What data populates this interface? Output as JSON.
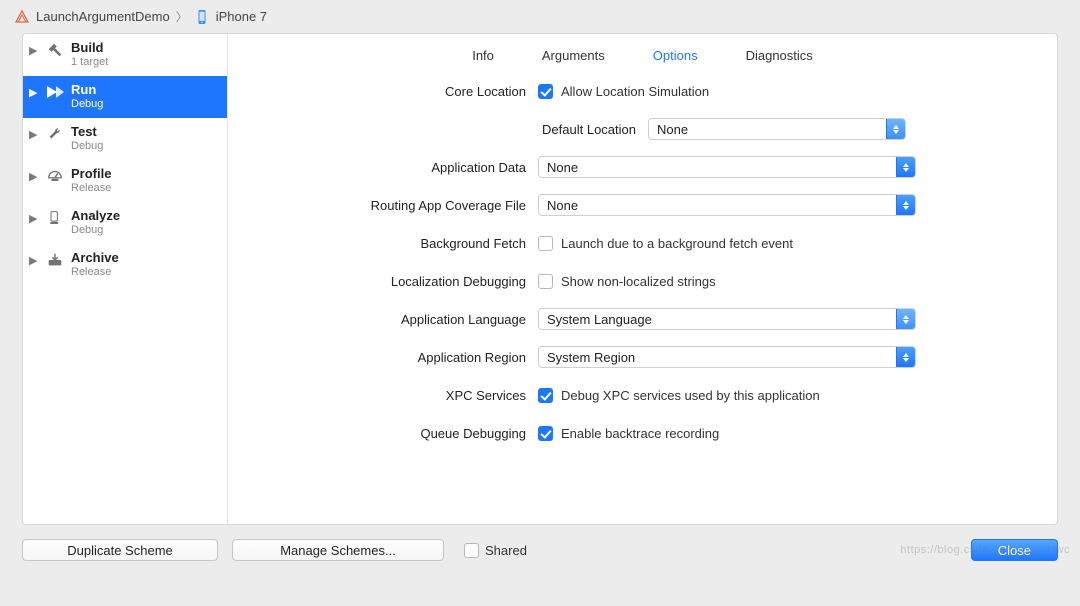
{
  "breadcrumb": {
    "scheme": "LaunchArgumentDemo",
    "device": "iPhone 7"
  },
  "sidebar": [
    {
      "title": "Build",
      "sub": "1 target",
      "icon": "hammer"
    },
    {
      "title": "Run",
      "sub": "Debug",
      "icon": "play",
      "selected": true
    },
    {
      "title": "Test",
      "sub": "Debug",
      "icon": "wrench"
    },
    {
      "title": "Profile",
      "sub": "Release",
      "icon": "gauge"
    },
    {
      "title": "Analyze",
      "sub": "Debug",
      "icon": "analyze"
    },
    {
      "title": "Archive",
      "sub": "Release",
      "icon": "archive"
    }
  ],
  "tabs": {
    "info": "Info",
    "arguments": "Arguments",
    "options": "Options",
    "diagnostics": "Diagnostics",
    "active": "options"
  },
  "form": {
    "core_location_label": "Core Location",
    "allow_loc_sim_label": "Allow Location Simulation",
    "allow_loc_sim_checked": true,
    "default_location_label": "Default Location",
    "default_location_value": "None",
    "app_data_label": "Application Data",
    "app_data_value": "None",
    "routing_label": "Routing App Coverage File",
    "routing_value": "None",
    "bg_fetch_label": "Background Fetch",
    "bg_fetch_cb_label": "Launch due to a background fetch event",
    "bg_fetch_checked": false,
    "loc_debug_label": "Localization Debugging",
    "loc_debug_cb_label": "Show non-localized strings",
    "loc_debug_checked": false,
    "app_lang_label": "Application Language",
    "app_lang_value": "System Language",
    "app_region_label": "Application Region",
    "app_region_value": "System Region",
    "xpc_label": "XPC Services",
    "xpc_cb_label": "Debug XPC services used by this application",
    "xpc_checked": true,
    "queue_label": "Queue Debugging",
    "queue_cb_label": "Enable backtrace recording",
    "queue_checked": true
  },
  "footer": {
    "duplicate": "Duplicate Scheme",
    "manage": "Manage Schemes...",
    "shared_label": "Shared",
    "shared_checked": false,
    "close": "Close"
  },
  "watermark": "https://blog.csdn.net/Hello_Hwc"
}
